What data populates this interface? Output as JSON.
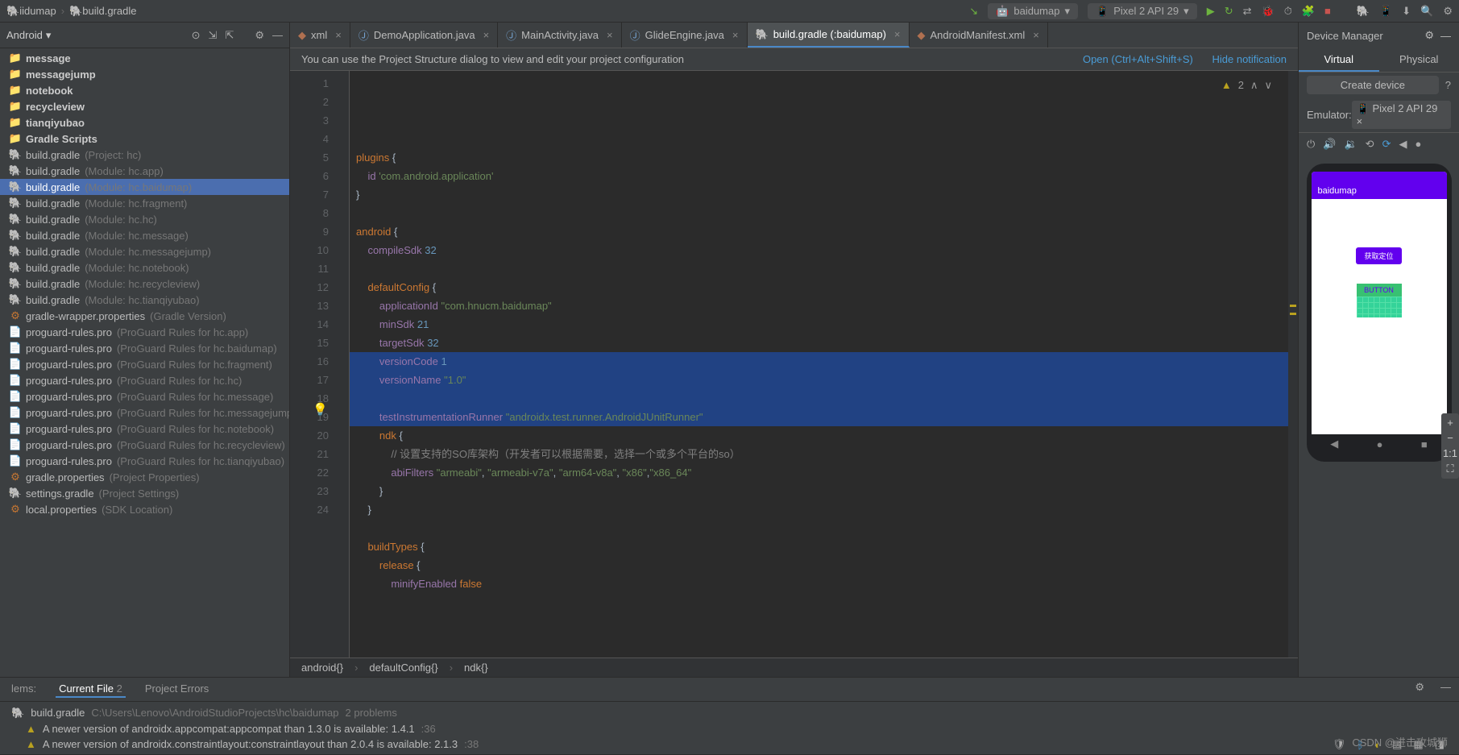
{
  "breadcrumb": {
    "root": "iidumap",
    "file": "build.gradle",
    "icon": "gradle-icon"
  },
  "toolbar": {
    "run_config": "baidumap",
    "device": "Pixel 2 API 29"
  },
  "sidebar": {
    "title": "Android",
    "modules": [
      "message",
      "messagejump",
      "notebook",
      "recycleview",
      "tianqiyubao",
      "Gradle Scripts"
    ],
    "items": [
      {
        "name": "build.gradle",
        "desc": "(Project: hc)",
        "type": "gradle"
      },
      {
        "name": "build.gradle",
        "desc": "(Module: hc.app)",
        "type": "gradle"
      },
      {
        "name": "build.gradle",
        "desc": "(Module: hc.baidumap)",
        "type": "gradle",
        "selected": true
      },
      {
        "name": "build.gradle",
        "desc": "(Module: hc.fragment)",
        "type": "gradle"
      },
      {
        "name": "build.gradle",
        "desc": "(Module: hc.hc)",
        "type": "gradle"
      },
      {
        "name": "build.gradle",
        "desc": "(Module: hc.message)",
        "type": "gradle"
      },
      {
        "name": "build.gradle",
        "desc": "(Module: hc.messagejump)",
        "type": "gradle"
      },
      {
        "name": "build.gradle",
        "desc": "(Module: hc.notebook)",
        "type": "gradle"
      },
      {
        "name": "build.gradle",
        "desc": "(Module: hc.recycleview)",
        "type": "gradle"
      },
      {
        "name": "build.gradle",
        "desc": "(Module: hc.tianqiyubao)",
        "type": "gradle"
      },
      {
        "name": "gradle-wrapper.properties",
        "desc": "(Gradle Version)",
        "type": "props"
      },
      {
        "name": "proguard-rules.pro",
        "desc": "(ProGuard Rules for hc.app)",
        "type": "paper"
      },
      {
        "name": "proguard-rules.pro",
        "desc": "(ProGuard Rules for hc.baidumap)",
        "type": "paper"
      },
      {
        "name": "proguard-rules.pro",
        "desc": "(ProGuard Rules for hc.fragment)",
        "type": "paper"
      },
      {
        "name": "proguard-rules.pro",
        "desc": "(ProGuard Rules for hc.hc)",
        "type": "paper"
      },
      {
        "name": "proguard-rules.pro",
        "desc": "(ProGuard Rules for hc.message)",
        "type": "paper"
      },
      {
        "name": "proguard-rules.pro",
        "desc": "(ProGuard Rules for hc.messagejump)",
        "type": "paper"
      },
      {
        "name": "proguard-rules.pro",
        "desc": "(ProGuard Rules for hc.notebook)",
        "type": "paper"
      },
      {
        "name": "proguard-rules.pro",
        "desc": "(ProGuard Rules for hc.recycleview)",
        "type": "paper"
      },
      {
        "name": "proguard-rules.pro",
        "desc": "(ProGuard Rules for hc.tianqiyubao)",
        "type": "paper"
      },
      {
        "name": "gradle.properties",
        "desc": "(Project Properties)",
        "type": "props"
      },
      {
        "name": "settings.gradle",
        "desc": "(Project Settings)",
        "type": "gradle"
      },
      {
        "name": "local.properties",
        "desc": "(SDK Location)",
        "type": "props"
      }
    ]
  },
  "tabs": [
    {
      "label": "xml",
      "type": "xml"
    },
    {
      "label": "DemoApplication.java",
      "type": "java"
    },
    {
      "label": "MainActivity.java",
      "type": "java"
    },
    {
      "label": "GlideEngine.java",
      "type": "java"
    },
    {
      "label": "build.gradle (:baidumap)",
      "type": "gradle",
      "active": true
    },
    {
      "label": "AndroidManifest.xml",
      "type": "xml"
    }
  ],
  "banner": {
    "text": "You can use the Project Structure dialog to view and edit your project configuration",
    "open": "Open (Ctrl+Alt+Shift+S)",
    "hide": "Hide notification"
  },
  "inspection": {
    "warn_count": "2"
  },
  "code": {
    "lines": [
      {
        "n": 1,
        "html": "<span class='kw'>plugins</span> <span class='def'>{</span>"
      },
      {
        "n": 2,
        "html": "    <span class='prop'>id</span> <span class='str'>'com.android.application'</span>"
      },
      {
        "n": 3,
        "html": "<span class='def'>}</span>"
      },
      {
        "n": 4,
        "html": ""
      },
      {
        "n": 5,
        "html": "<span class='kw'>android</span> <span class='def'>{</span>"
      },
      {
        "n": 6,
        "html": "    <span class='prop'>compileSdk</span> <span class='num'>32</span>"
      },
      {
        "n": 7,
        "html": ""
      },
      {
        "n": 8,
        "html": "    <span class='kw'>defaultConfig</span> <span class='def'>{</span>"
      },
      {
        "n": 9,
        "html": "        <span class='prop'>applicationId</span> <span class='str'>\"com.hnucm.baidumap\"</span>"
      },
      {
        "n": 10,
        "html": "        <span class='prop'>minSdk</span> <span class='num'>21</span>"
      },
      {
        "n": 11,
        "html": "        <span class='prop'>targetSdk</span> <span class='num'>32</span>"
      },
      {
        "n": 12,
        "html": "        <span class='prop'>versionCode</span> <span class='num'>1</span>"
      },
      {
        "n": 13,
        "html": "        <span class='prop'>versionName</span> <span class='str'>\"1.0\"</span>"
      },
      {
        "n": 14,
        "html": ""
      },
      {
        "n": 15,
        "html": "        <span class='prop'>testInstrumentationRunner</span> <span class='str'>\"androidx.test.runner.AndroidJUnitRunner\"</span>"
      },
      {
        "n": 16,
        "html": "        <span class='kw'>ndk</span> <span class='def'>{</span>",
        "hl": true
      },
      {
        "n": 17,
        "html": "            <span class='cmt'>// 设置支持的SO库架构（开发者可以根据需要，选择一个或多个平台的so）</span>",
        "hl": true
      },
      {
        "n": 18,
        "html": "            <span class='prop'>abiFilters</span> <span class='str'>\"armeabi\"</span><span class='def'>,</span> <span class='str'>\"armeabi-v7a\"</span><span class='def'>,</span> <span class='str'>\"arm64-v8a\"</span><span class='def'>,</span> <span class='str'>\"x86\"</span><span class='def'>,</span><span class='str'>\"x86_64\"</span>",
        "hl": true
      },
      {
        "n": 19,
        "html": "        <span class='def'>}</span>",
        "hl": true
      },
      {
        "n": 20,
        "html": "    <span class='def'>}</span>"
      },
      {
        "n": 21,
        "html": ""
      },
      {
        "n": 22,
        "html": "    <span class='kw'>buildTypes</span> <span class='def'>{</span>"
      },
      {
        "n": 23,
        "html": "        <span class='kw'>release</span> <span class='def'>{</span>"
      },
      {
        "n": 24,
        "html": "            <span class='prop'>minifyEnabled</span> <span class='kw'>false</span>"
      }
    ]
  },
  "editor_breadcrumb": [
    "android{}",
    "defaultConfig{}",
    "ndk{}"
  ],
  "device_manager": {
    "title": "Device Manager",
    "tabs": [
      "Virtual",
      "Physical"
    ],
    "create": "Create device",
    "emulator_label": "Emulator:",
    "emulator_device": "Pixel 2 API 29"
  },
  "emulator": {
    "app_title": "baidumap",
    "button1": "获取定位",
    "button2": "BUTTON",
    "zoom": "1:1"
  },
  "problems": {
    "tabs": [
      {
        "label": "lems:"
      },
      {
        "label": "Current File",
        "count": "2",
        "active": true
      },
      {
        "label": "Project Errors"
      }
    ],
    "file": "build.gradle",
    "file_path": "C:\\Users\\Lenovo\\AndroidStudioProjects\\hc\\baidumap",
    "file_count": "2 problems",
    "items": [
      {
        "text": "A newer version of androidx.appcompat:appcompat than 1.3.0 is available: 1.4.1",
        "loc": ":36"
      },
      {
        "text": "A newer version of androidx.constraintlayout:constraintlayout than 2.0.4 is available: 2.1.3",
        "loc": ":38"
      }
    ]
  },
  "watermark": "CSDN @进击攻城狮"
}
